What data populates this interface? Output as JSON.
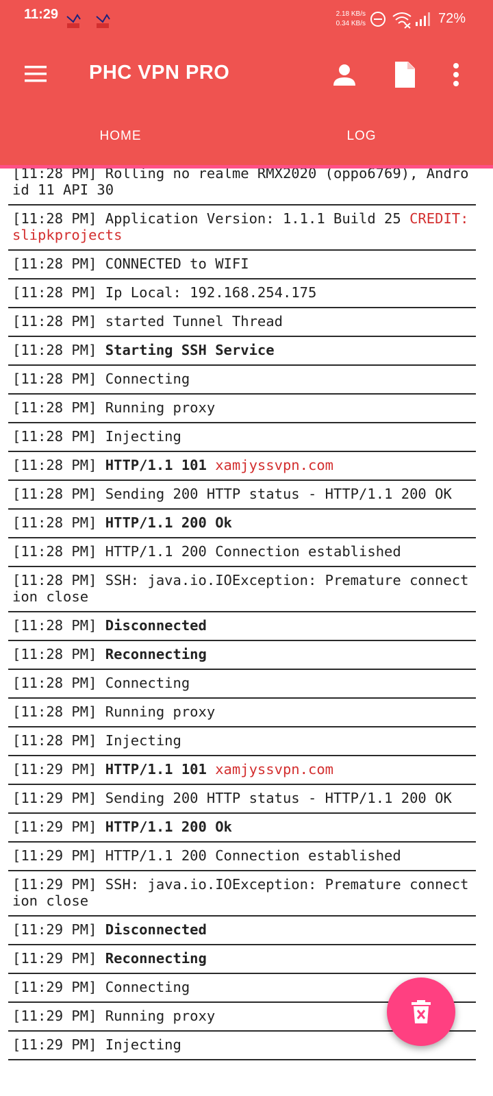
{
  "status_bar": {
    "time": "11:29",
    "speed_down": "2.18 KB/s",
    "speed_up": "0.34 KB/s",
    "battery": "72%"
  },
  "app": {
    "title": "PHC VPN PRO",
    "accent_color": "#ef5350",
    "fab_color": "#ff4081"
  },
  "tabs": [
    {
      "label": "HOME"
    },
    {
      "label": "LOG"
    }
  ],
  "icons": {
    "menu": "menu-icon",
    "account": "account-icon",
    "document": "document-icon",
    "more": "more-vert-icon",
    "fab": "delete-icon"
  },
  "log": [
    {
      "parts": [
        {
          "t": "[11:28 PM] Rolling no realme RMX2020 (oppo6769), Android 11 API 30"
        }
      ]
    },
    {
      "parts": [
        {
          "t": "[11:28 PM] Application Version: 1.1.1 Build 25 "
        },
        {
          "t": "CREDIT: slipkprojects",
          "s": "red"
        }
      ]
    },
    {
      "parts": [
        {
          "t": "[11:28 PM] CONNECTED to WIFI"
        }
      ]
    },
    {
      "parts": [
        {
          "t": "[11:28 PM] Ip Local: 192.168.254.175"
        }
      ]
    },
    {
      "parts": [
        {
          "t": "[11:28 PM] started Tunnel Thread"
        }
      ]
    },
    {
      "parts": [
        {
          "t": "[11:28 PM] "
        },
        {
          "t": "Starting SSH Service",
          "s": "bold"
        }
      ]
    },
    {
      "parts": [
        {
          "t": "[11:28 PM] Connecting"
        }
      ]
    },
    {
      "parts": [
        {
          "t": "[11:28 PM] Running proxy"
        }
      ]
    },
    {
      "parts": [
        {
          "t": "[11:28 PM] Injecting"
        }
      ]
    },
    {
      "parts": [
        {
          "t": "[11:28 PM] "
        },
        {
          "t": "HTTP/1.1 101 ",
          "s": "bold"
        },
        {
          "t": "xamjyssvpn.com",
          "s": "red"
        }
      ]
    },
    {
      "parts": [
        {
          "t": "[11:28 PM] Sending 200 HTTP status - HTTP/1.1 200 OK"
        }
      ]
    },
    {
      "parts": [
        {
          "t": "[11:28 PM] "
        },
        {
          "t": "HTTP/1.1 200 Ok",
          "s": "bold"
        }
      ]
    },
    {
      "parts": [
        {
          "t": "[11:28 PM] HTTP/1.1 200 Connection established"
        }
      ]
    },
    {
      "parts": [
        {
          "t": "[11:28 PM] SSH: java.io.IOException: Premature connection close"
        }
      ]
    },
    {
      "parts": [
        {
          "t": "[11:28 PM] "
        },
        {
          "t": "Disconnected",
          "s": "bold"
        }
      ]
    },
    {
      "parts": [
        {
          "t": "[11:28 PM] "
        },
        {
          "t": "Reconnecting",
          "s": "bold"
        }
      ]
    },
    {
      "parts": [
        {
          "t": "[11:28 PM] Connecting"
        }
      ]
    },
    {
      "parts": [
        {
          "t": "[11:28 PM] Running proxy"
        }
      ]
    },
    {
      "parts": [
        {
          "t": "[11:28 PM] Injecting"
        }
      ]
    },
    {
      "parts": [
        {
          "t": "[11:29 PM] "
        },
        {
          "t": "HTTP/1.1 101 ",
          "s": "bold"
        },
        {
          "t": "xamjyssvpn.com",
          "s": "red"
        }
      ]
    },
    {
      "parts": [
        {
          "t": "[11:29 PM] Sending 200 HTTP status - HTTP/1.1 200 OK"
        }
      ]
    },
    {
      "parts": [
        {
          "t": "[11:29 PM] "
        },
        {
          "t": "HTTP/1.1 200 Ok",
          "s": "bold"
        }
      ]
    },
    {
      "parts": [
        {
          "t": "[11:29 PM] HTTP/1.1 200 Connection established"
        }
      ]
    },
    {
      "parts": [
        {
          "t": "[11:29 PM] SSH: java.io.IOException: Premature connection close"
        }
      ]
    },
    {
      "parts": [
        {
          "t": "[11:29 PM] "
        },
        {
          "t": "Disconnected",
          "s": "bold"
        }
      ]
    },
    {
      "parts": [
        {
          "t": "[11:29 PM] "
        },
        {
          "t": "Reconnecting",
          "s": "bold"
        }
      ]
    },
    {
      "parts": [
        {
          "t": "[11:29 PM] Connecting"
        }
      ]
    },
    {
      "parts": [
        {
          "t": "[11:29 PM] Running proxy"
        }
      ]
    },
    {
      "parts": [
        {
          "t": "[11:29 PM] Injecting"
        }
      ]
    }
  ]
}
